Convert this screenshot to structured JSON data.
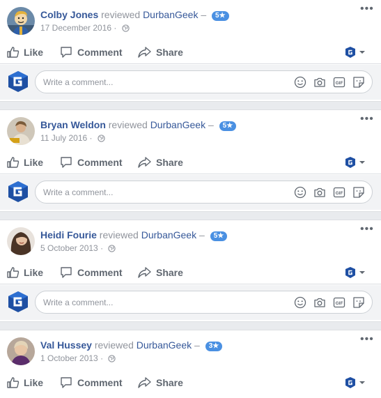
{
  "reviews": [
    {
      "reviewer": "Colby Jones",
      "verb": "reviewed",
      "page": "DurbanGeek",
      "dash": "–",
      "rating": "5★",
      "date": "17 December 2016",
      "separator": "·",
      "avatar": "fallout-vault-boy-avatar"
    },
    {
      "reviewer": "Bryan Weldon",
      "verb": "reviewed",
      "page": "DurbanGeek",
      "dash": "–",
      "rating": "5★",
      "date": "11 July 2016",
      "separator": "·",
      "avatar": "user-photo-avatar"
    },
    {
      "reviewer": "Heidi Fourie",
      "verb": "reviewed",
      "page": "DurbanGeek",
      "dash": "–",
      "rating": "5★",
      "date": "5 October 2013",
      "separator": "·",
      "avatar": "user-photo-avatar"
    },
    {
      "reviewer": "Val Hussey",
      "verb": "reviewed",
      "page": "DurbanGeek",
      "dash": "–",
      "rating": "3★",
      "date": "1 October 2013",
      "separator": "·",
      "avatar": "user-photo-avatar"
    }
  ],
  "actions": {
    "like": "Like",
    "comment": "Comment",
    "share": "Share"
  },
  "composer": {
    "placeholder": "Write a comment..."
  },
  "icons": {
    "more": "more-options-icon",
    "like": "thumbs-up-icon",
    "comment": "speech-bubble-icon",
    "share": "share-arrow-icon",
    "privacy": "globe-icon",
    "emoji": "emoji-icon",
    "photo": "camera-icon",
    "gif": "gif-icon",
    "sticker": "sticker-icon",
    "page_logo": "durbangeek-logo-icon"
  },
  "colors": {
    "link": "#365899",
    "muted": "#90949c",
    "action": "#606770",
    "badge": "#4a90e2",
    "logo": "#1e4fa3"
  }
}
